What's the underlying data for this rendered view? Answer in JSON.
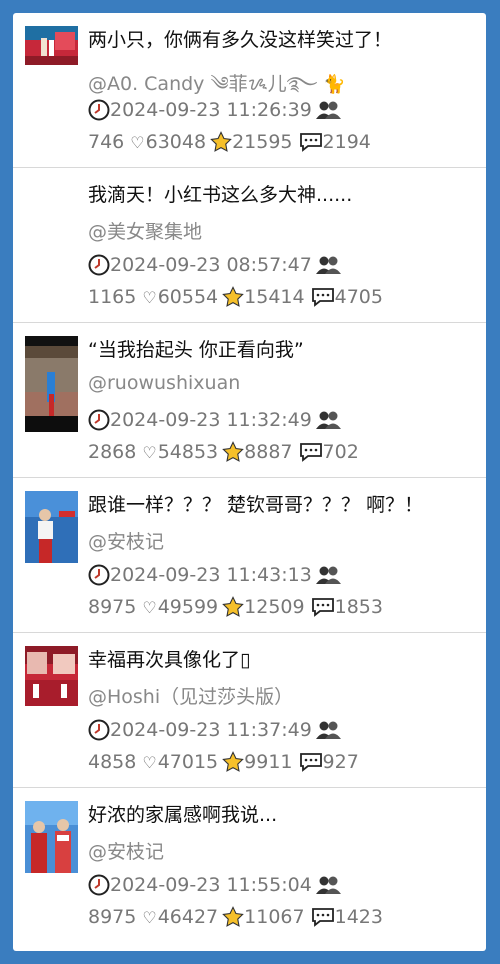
{
  "posts": [
    {
      "title": "两小只，你俩有多久没这样笑过了！",
      "author": "@A0. Candy ༄菲ᝰ儿࿐",
      "author_extra": "🐈",
      "timestamp": "2024-09-23 11:26:39",
      "views": "746",
      "likes": "63048",
      "favorites": "21595",
      "comments": "2194"
    },
    {
      "title": "我滴天！小红书这么多大神......",
      "author": "@美女聚集地",
      "timestamp": "2024-09-23 08:57:47",
      "views": "1165",
      "likes": "60554",
      "favorites": "15414",
      "comments": "4705"
    },
    {
      "title": "“当我抬起头 你正看向我”",
      "author": "@ruowushixuan",
      "timestamp": "2024-09-23 11:32:49",
      "views": "2868",
      "likes": "54853",
      "favorites": "8887",
      "comments": "702"
    },
    {
      "title": "跟谁一样？？？ 楚钦哥哥？？？ 啊？！",
      "author": "@安枝记",
      "timestamp": "2024-09-23 11:43:13",
      "views": "8975",
      "likes": "49599",
      "favorites": "12509",
      "comments": "1853"
    },
    {
      "title": "幸福再次具像化了▯",
      "author": "@Hoshi（见过莎头版）",
      "timestamp": "2024-09-23 11:37:49",
      "views": "4858",
      "likes": "47015",
      "favorites": "9911",
      "comments": "927"
    },
    {
      "title": "好浓的家属感啊我说...",
      "author": "@安枝记",
      "timestamp": "2024-09-23 11:55:04",
      "views": "8975",
      "likes": "46427",
      "favorites": "11067",
      "comments": "1423"
    }
  ],
  "icons": {
    "time": "clock-icon",
    "people": "people-icon",
    "like": "heart-icon",
    "favorite": "star-icon",
    "comment": "comment-icon"
  },
  "colors": {
    "background": "#3a7dbf",
    "card": "#ffffff",
    "star": "#f6c02a"
  }
}
